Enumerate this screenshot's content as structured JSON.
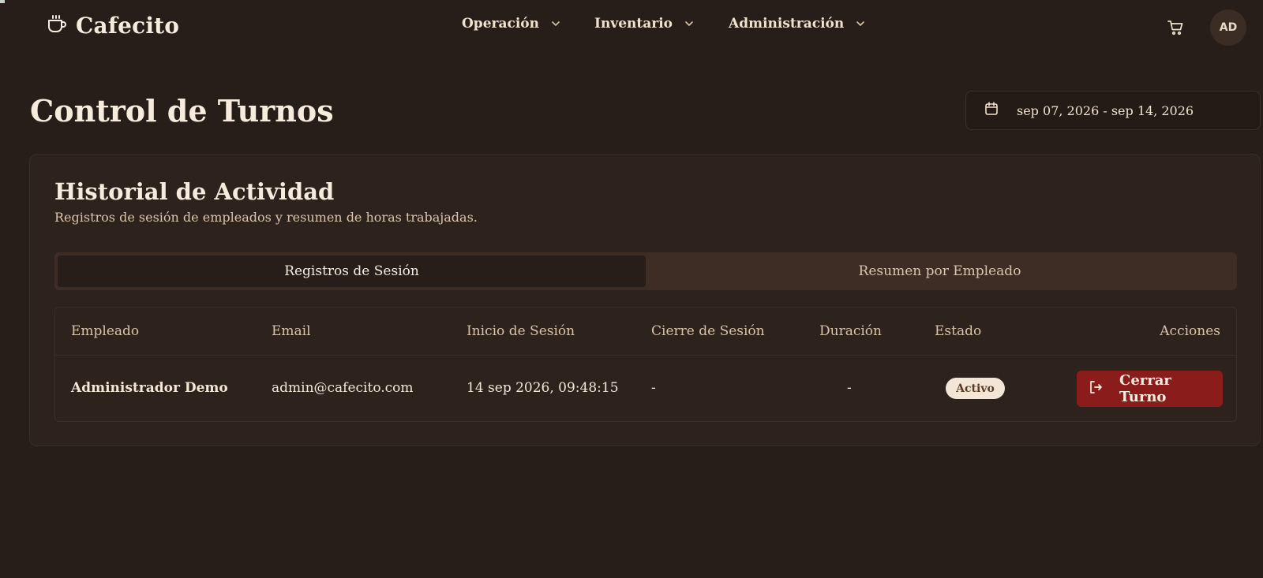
{
  "app": {
    "brand": "Cafecito"
  },
  "nav": {
    "items": [
      {
        "label": "Operación"
      },
      {
        "label": "Inventario"
      },
      {
        "label": "Administración"
      }
    ],
    "avatar_initials": "AD"
  },
  "page": {
    "title": "Control de Turnos",
    "date_range": "sep 07, 2026 - sep 14, 2026"
  },
  "card": {
    "title": "Historial de Actividad",
    "subtitle": "Registros de sesión de empleados y resumen de horas trabajadas.",
    "tabs": [
      {
        "label": "Registros de Sesión",
        "active": true
      },
      {
        "label": "Resumen por Empleado",
        "active": false
      }
    ]
  },
  "table": {
    "headers": {
      "employee": "Empleado",
      "email": "Email",
      "start": "Inicio de Sesión",
      "end": "Cierre de Sesión",
      "duration": "Duración",
      "status": "Estado",
      "actions": "Acciones"
    },
    "rows": [
      {
        "employee": "Administrador Demo",
        "email": "admin@cafecito.com",
        "start": "14 sep 2026, 09:48:15",
        "end": "-",
        "duration": "-",
        "status": "Activo",
        "action": "Cerrar Turno"
      }
    ]
  },
  "colors": {
    "background": "#271e19",
    "card": "#2e221d",
    "accent_danger": "#8a1d1c",
    "badge_bg": "#f4e6d6"
  },
  "icons": {
    "brand": "coffee-cup-icon",
    "cart": "shopping-cart-icon",
    "calendar": "calendar-icon",
    "logout": "logout-icon",
    "chevron": "chevron-down-icon"
  }
}
